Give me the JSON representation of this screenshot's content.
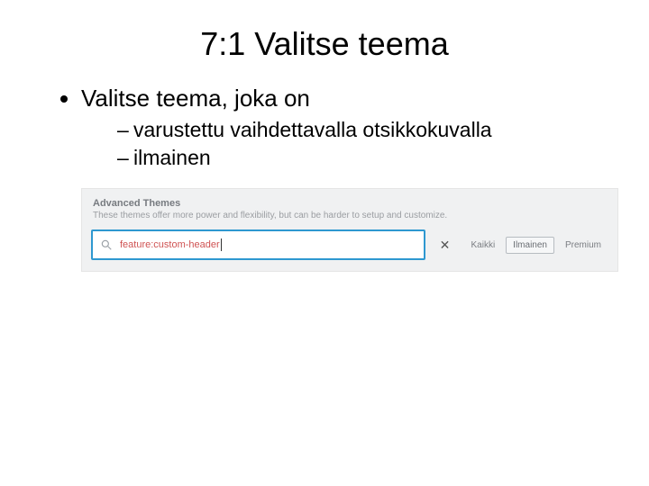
{
  "title": "7:1 Valitse teema",
  "bullets": {
    "b1": "Valitse teema, joka on",
    "sub1": "varustettu vaihdettavalla otsikkokuvalla",
    "sub2": "ilmainen"
  },
  "panel": {
    "heading": "Advanced Themes",
    "subheading": "These themes offer more power and flexibility, but can be harder to setup and customize.",
    "search_value": "feature:custom-header",
    "close_glyph": "✕",
    "filters": {
      "all": "Kaikki",
      "free": "Ilmainen",
      "premium": "Premium"
    }
  }
}
